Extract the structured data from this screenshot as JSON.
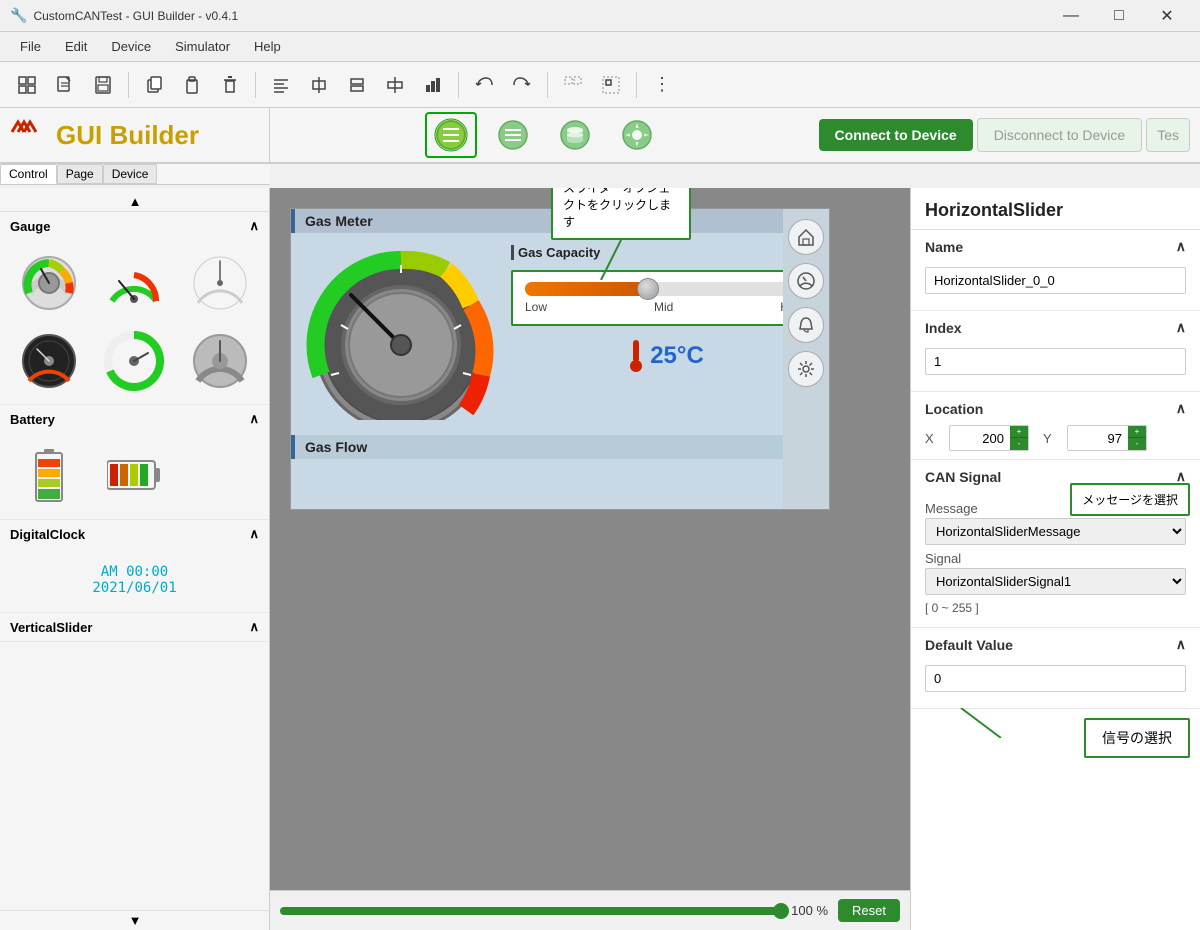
{
  "titlebar": {
    "title": "CustomCANTest - GUI Builder - v0.4.1",
    "min": "—",
    "max": "□",
    "close": "✕"
  },
  "menubar": {
    "items": [
      "File",
      "Edit",
      "Device",
      "Simulator",
      "Help"
    ]
  },
  "toolbar": {
    "buttons": [
      "⊞",
      "📄",
      "💾",
      "⧉",
      "📋",
      "🗑",
      "⬛⬛",
      "⊕",
      "⊡",
      "⊞",
      "⊕",
      "📊",
      "↩",
      "↪",
      "⬚",
      "⬚⬚",
      "⋮"
    ]
  },
  "devicebar": {
    "logo_text": "GUI Builder",
    "icons": [
      "grid",
      "list",
      "database",
      "gear"
    ],
    "connect_label": "Connect to Device",
    "disconnect_label": "Disconnect to Device",
    "test_label": "Tes"
  },
  "tabs": [
    "Control",
    "Page",
    "Device"
  ],
  "sidebar": {
    "sections": [
      {
        "name": "Gauge",
        "expanded": true
      },
      {
        "name": "Battery",
        "expanded": true
      },
      {
        "name": "DigitalClock",
        "expanded": true
      },
      {
        "name": "VerticalSlider",
        "expanded": true
      }
    ],
    "clock_display": "AM 00:00\n2021/06/01"
  },
  "canvas": {
    "gas_meter_label": "Gas Meter",
    "gas_capacity_label": "Gas Capacity",
    "slider_labels": [
      "Low",
      "Mid",
      "High"
    ],
    "temp_display": "25°C",
    "gas_flow_label": "Gas Flow",
    "tooltip_text": "スライダーオブジェクトをクリックします",
    "zoom_percent": "100 %",
    "reset_label": "Reset"
  },
  "right_panel": {
    "title": "HorizontalSlider",
    "name_label": "Name",
    "name_value": "HorizontalSlider_0_0",
    "index_label": "Index",
    "index_value": "1",
    "location_label": "Location",
    "x_label": "X",
    "x_value": "200",
    "y_label": "Y",
    "y_value": "97",
    "can_signal_label": "CAN Signal",
    "message_label": "Message",
    "message_value": "HorizontalSliderMessage",
    "signal_label": "Signal",
    "signal_value": "HorizontalSliderSignal1",
    "range_text": "[ 0 ~ 255 ]",
    "default_label": "Default Value",
    "default_value": "0",
    "tooltip2_text": "メッセージを選択",
    "tooltip3_text": "信号の選択"
  }
}
